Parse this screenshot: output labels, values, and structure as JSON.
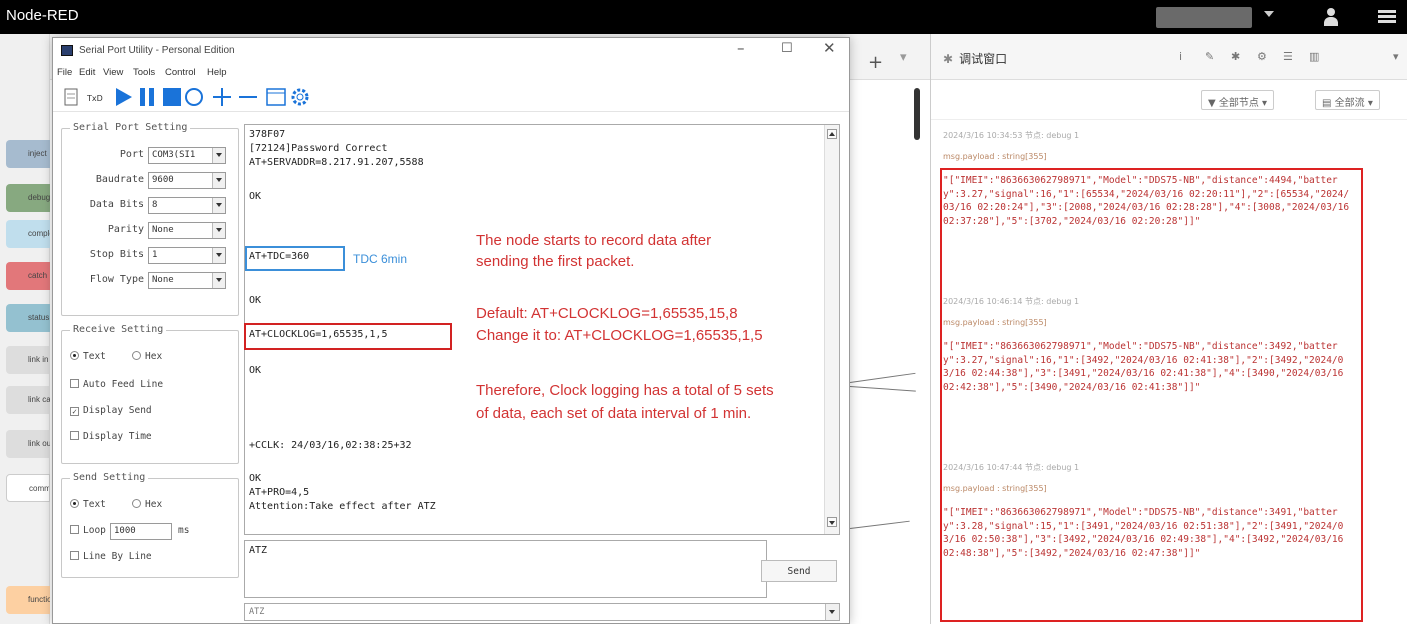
{
  "nodered": {
    "title": "Node-RED",
    "palette": [
      "inject",
      "debug",
      "complete",
      "catch",
      "status",
      "link in",
      "link call",
      "link out",
      "comment",
      "function"
    ],
    "sidebar": {
      "title": "调试窗口",
      "filter_node": "全部节点",
      "filter_clear": "全部流",
      "messages": [
        {
          "meta": "2024/3/16 10:34:53   节点: debug 1",
          "topic": "msg.payload : string[355]",
          "body": "\"[\"IMEI\":\"863663062798971\",\"Model\":\"DDS75-NB\",\"distance\":4494,\"battery\":3.27,\"signal\":16,\"1\":[65534,\"2024/03/16 02:20:11\"],\"2\":[65534,\"2024/03/16 02:20:24\"],\"3\":[2008,\"2024/03/16 02:28:28\"],\"4\":[3008,\"2024/03/16 02:37:28\"],\"5\":[3702,\"2024/03/16 02:20:28\"]]\""
        },
        {
          "meta": "2024/3/16 10:46:14   节点: debug 1",
          "topic": "msg.payload : string[355]",
          "body": "\"[\"IMEI\":\"863663062798971\",\"Model\":\"DDS75-NB\",\"distance\":3492,\"battery\":3.27,\"signal\":16,\"1\":[3492,\"2024/03/16 02:41:38\"],\"2\":[3492,\"2024/03/16 02:44:38\"],\"3\":[3491,\"2024/03/16 02:41:38\"],\"4\":[3490,\"2024/03/16 02:42:38\"],\"5\":[3490,\"2024/03/16 02:41:38\"]]\""
        },
        {
          "meta": "2024/3/16 10:47:44   节点: debug 1",
          "topic": "msg.payload : string[355]",
          "body": "\"[\"IMEI\":\"863663062798971\",\"Model\":\"DDS75-NB\",\"distance\":3491,\"battery\":3.28,\"signal\":15,\"1\":[3491,\"2024/03/16 02:51:38\"],\"2\":[3491,\"2024/03/16 02:50:38\"],\"3\":[3492,\"2024/03/16 02:49:38\"],\"4\":[3492,\"2024/03/16 02:48:38\"],\"5\":[3492,\"2024/03/16 02:47:38\"]]\""
        }
      ]
    }
  },
  "spu": {
    "title": "Serial Port Utility - Personal Edition",
    "menu": [
      "File",
      "Edit",
      "View",
      "Tools",
      "Control",
      "Help"
    ],
    "serial": {
      "title": "Serial Port Setting",
      "port_label": "Port",
      "port_value": "COM3(SI1",
      "baud_label": "Baudrate",
      "baud_value": "9600",
      "data_label": "Data Bits",
      "data_value": "8",
      "parity_label": "Parity",
      "parity_value": "None",
      "stop_label": "Stop Bits",
      "stop_value": "1",
      "flow_label": "Flow Type",
      "flow_value": "None"
    },
    "receive": {
      "title": "Receive Setting",
      "text": "Text",
      "hex": "Hex",
      "auto_feed": "Auto Feed Line",
      "display_send": "Display Send",
      "display_time": "Display Time"
    },
    "send": {
      "title": "Send Setting",
      "text": "Text",
      "hex": "Hex",
      "loop": "Loop",
      "loop_value": "1000",
      "loop_unit": "ms",
      "line_by_line": "Line By Line",
      "input": "ATZ",
      "button": "Send",
      "history": "ATZ"
    },
    "log": [
      "378F07",
      "[72124]Password Correct",
      "AT+SERVADDR=8.217.91.207,5588",
      "OK",
      "AT+TDC=360",
      "OK",
      "AT+CLOCKLOG=1,65535,1,5",
      "OK",
      "+CCLK: 24/03/16,02:38:25+32",
      "OK",
      "AT+PRO=4,5",
      "Attention:Take effect after ATZ"
    ],
    "tdc_note": "TDC 6min",
    "annotations": [
      "The node starts to record data after",
      "sending the first packet.",
      "Default: AT+CLOCKLOG=1,65535,15,8",
      "Change it to: AT+CLOCKLOG=1,65535,1,5",
      "Therefore, Clock logging has a total of 5 sets",
      "of data, each set of data interval of 1 min."
    ]
  },
  "colors": {
    "annotation": "#d23333",
    "tdc_box": "#3b8fd9",
    "highlight_box": "#d22222"
  }
}
